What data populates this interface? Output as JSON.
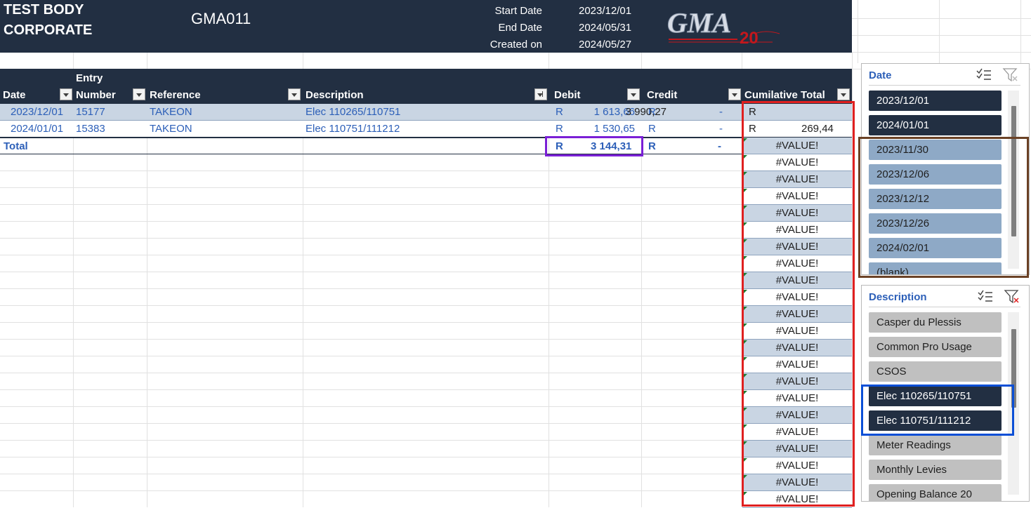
{
  "header": {
    "org_name": "TEST BODY CORPORATE",
    "account_code": "GMA011",
    "start_label": "Start Date",
    "start_value": "2023/12/01",
    "end_label": "End Date",
    "end_value": "2024/05/31",
    "created_label": "Created on",
    "created_value": "2024/05/27",
    "logo_text": "GMA",
    "logo_badge": "20"
  },
  "table": {
    "columns": {
      "date": "Date",
      "entry_line1": "Entry",
      "entry_line2": "Number",
      "reference": "Reference",
      "description": "Description",
      "debit": "Debit",
      "credit": "Credit",
      "cumulative": "Cumilative Total"
    },
    "rows": [
      {
        "date": "2023/12/01",
        "entry": "15177",
        "reference": "TAKEON",
        "description": "Elec 110265/110751",
        "debit_cur": "R",
        "debit": "1 613,66",
        "credit_cur": "R",
        "credit": "-",
        "cum_cur": "R",
        "cum": "3 990,27"
      },
      {
        "date": "2024/01/01",
        "entry": "15383",
        "reference": "TAKEON",
        "description": "Elec 110751/111212",
        "debit_cur": "R",
        "debit": "1 530,65",
        "credit_cur": "R",
        "credit": "-",
        "cum_cur": "R",
        "cum": "269,44"
      }
    ],
    "total": {
      "label": "Total",
      "debit_cur": "R",
      "debit": "3 144,31",
      "credit_cur": "R",
      "credit": "-"
    },
    "error_value": "#VALUE!",
    "error_count": 22
  },
  "slicers": {
    "date": {
      "title": "Date",
      "items": [
        {
          "label": "2023/12/01",
          "state": "selected"
        },
        {
          "label": "2024/01/01",
          "state": "selected"
        },
        {
          "label": "2023/11/30",
          "state": "nodata"
        },
        {
          "label": "2023/12/06",
          "state": "nodata"
        },
        {
          "label": "2023/12/12",
          "state": "nodata"
        },
        {
          "label": "2023/12/26",
          "state": "nodata"
        },
        {
          "label": "2024/02/01",
          "state": "nodata"
        },
        {
          "label": "(blank)",
          "state": "nodata"
        }
      ]
    },
    "description": {
      "title": "Description",
      "items": [
        {
          "label": "Casper du Plessis",
          "state": "unselected"
        },
        {
          "label": "Common Pro Usage",
          "state": "unselected"
        },
        {
          "label": "CSOS",
          "state": "unselected"
        },
        {
          "label": "Elec 110265/110751",
          "state": "selected"
        },
        {
          "label": "Elec 110751/111212",
          "state": "selected"
        },
        {
          "label": "Meter Readings",
          "state": "unselected"
        },
        {
          "label": "Monthly Levies",
          "state": "unselected"
        },
        {
          "label": "Opening Balance 20",
          "state": "unselected"
        }
      ]
    }
  },
  "colors": {
    "header_bg": "#222f42",
    "row_band": "#c9d5e3",
    "link_blue": "#2c5fb8",
    "box_red": "#e02020",
    "box_purple": "#7a1fd6",
    "box_brown": "#6b4226",
    "box_blue": "#0b4fd6"
  }
}
